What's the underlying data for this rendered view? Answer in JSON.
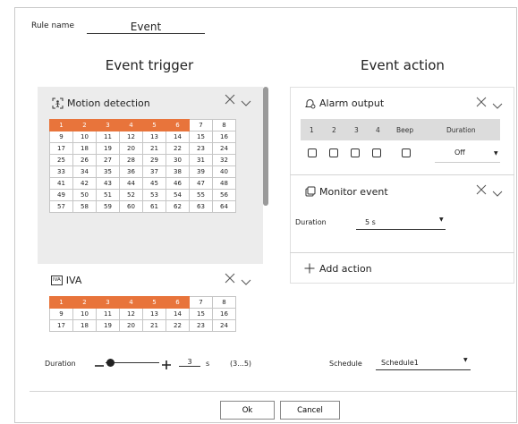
{
  "rule": {
    "label": "Rule name",
    "value": "Event"
  },
  "trigger": {
    "title": "Event trigger",
    "motion": {
      "label": "Motion detection",
      "cells": [
        "1",
        "2",
        "3",
        "4",
        "5",
        "6",
        "7",
        "8",
        "9",
        "10",
        "11",
        "12",
        "13",
        "14",
        "15",
        "16",
        "17",
        "18",
        "19",
        "20",
        "21",
        "22",
        "23",
        "24",
        "25",
        "26",
        "27",
        "28",
        "29",
        "30",
        "31",
        "32",
        "33",
        "34",
        "35",
        "36",
        "37",
        "38",
        "39",
        "40",
        "41",
        "42",
        "43",
        "44",
        "45",
        "46",
        "47",
        "48",
        "49",
        "50",
        "51",
        "52",
        "53",
        "54",
        "55",
        "56",
        "57",
        "58",
        "59",
        "60",
        "61",
        "62",
        "63",
        "64"
      ],
      "selected_count": 6
    },
    "iva": {
      "label": "IVA",
      "icon_text": "IVA",
      "cells": [
        "1",
        "2",
        "3",
        "4",
        "5",
        "6",
        "7",
        "8",
        "9",
        "10",
        "11",
        "12",
        "13",
        "14",
        "15",
        "16",
        "17",
        "18",
        "19",
        "20",
        "21",
        "22",
        "23",
        "24"
      ],
      "selected_count": 6
    }
  },
  "action": {
    "title": "Event action",
    "alarm": {
      "label": "Alarm output",
      "columns": [
        "1",
        "2",
        "3",
        "4",
        "Beep",
        "Duration"
      ],
      "duration_value": "Off"
    },
    "monitor": {
      "label": "Monitor event",
      "duration_label": "Duration",
      "duration_value": "5 s"
    },
    "add_label": "Add action"
  },
  "footer": {
    "duration_label": "Duration",
    "duration_value": "3",
    "duration_unit": "s",
    "duration_range": "(3...5)",
    "schedule_label": "Schedule",
    "schedule_value": "Schedule1",
    "ok_label": "Ok",
    "cancel_label": "Cancel"
  },
  "colors": {
    "selected_cell": "#e8743b",
    "panel_bg": "#ececec"
  },
  "icons": {
    "close": "close-icon",
    "collapse": "chevron-down-icon",
    "plus": "plus-icon",
    "minus": "minus-icon",
    "dropdown": "dropdown-arrow-icon"
  }
}
